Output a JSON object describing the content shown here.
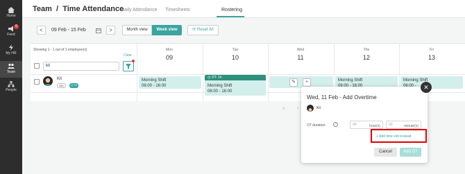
{
  "nav": {
    "items": [
      {
        "label": "Home",
        "icon": "home-icon"
      },
      {
        "label": "Feed",
        "icon": "megaphone-icon",
        "badge": "6"
      },
      {
        "label": "My HR",
        "icon": "lightning-icon"
      },
      {
        "label": "Team",
        "icon": "team-icon"
      },
      {
        "label": "People",
        "icon": "org-chart-icon"
      }
    ]
  },
  "header": {
    "title": "Team  /  Time Attendance",
    "tabs": [
      "Daily Attendance",
      "Timesheets",
      "Rostering"
    ],
    "active_tab": "Rostering"
  },
  "toolbar": {
    "prev": "<",
    "next": ">",
    "date_range": "09 Feb - 15 Feb",
    "month_view": "Month view",
    "week_view": "Week view",
    "reset": "Reset All"
  },
  "filter": {
    "showing": "Showing 1 - 1 out of 1 employee(s)",
    "clear": "Clear",
    "search_value": "kit"
  },
  "days": [
    {
      "name": "Mon",
      "num": "09"
    },
    {
      "name": "Tue",
      "num": "10"
    },
    {
      "name": "Wed",
      "num": "11"
    },
    {
      "name": "Thu",
      "num": "12"
    },
    {
      "name": "Fri",
      "num": "13"
    }
  ],
  "employee": {
    "name": "Kit",
    "hours": "48h",
    "ot": "1h"
  },
  "shift": {
    "name": "Morning Shift",
    "time": "06:00 - 16:00",
    "ot_tag": "OT: 1h",
    "fri_time": "06:00 -"
  },
  "pager": {
    "first": "«",
    "prev": "‹"
  },
  "popup": {
    "title": "Wed, 11 Feb - Add Overtime",
    "employee": "Kit",
    "ot_label": "OT duration:",
    "hours_placeholder": "00",
    "hours_suffix": "hour(s)",
    "minutes_placeholder": "00",
    "minutes_suffix": "minute(s)",
    "add_slot": "+ Add time slot instead",
    "cancel": "Cancel",
    "add_ot": "Add OT"
  },
  "colors": {
    "accent": "#3aa5a0",
    "shift_bg": "#d2efec",
    "nav_bg": "#2d2d2d",
    "highlight_box": "#e00000"
  }
}
